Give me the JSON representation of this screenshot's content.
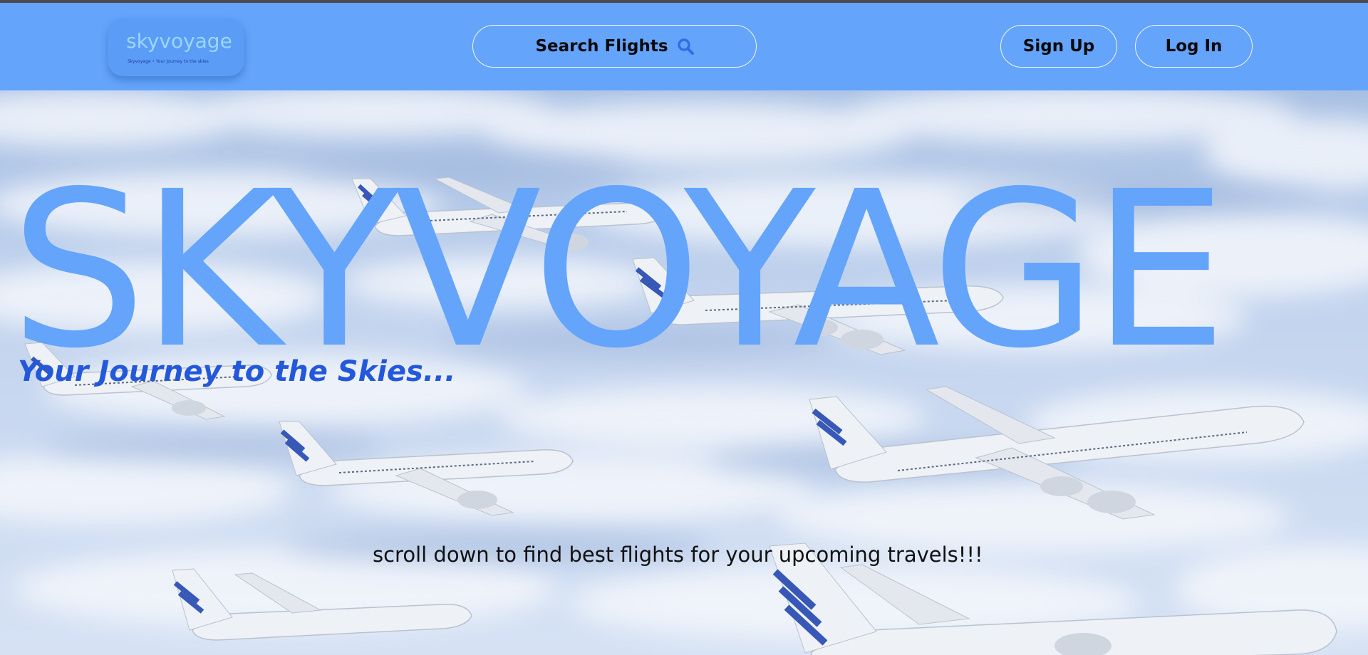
{
  "navbar": {
    "logo_text": "skyvoyage",
    "logo_tagline": "Skyvoyage • Your journey to the skies",
    "search_label": "Search Flights",
    "signup_label": "Sign Up",
    "login_label": "Log In"
  },
  "hero": {
    "title": "SKYVOYAGE",
    "subtitle": "Your Journey to the Skies...",
    "note": "scroll down to find best flights for your upcoming travels!!!"
  },
  "colors": {
    "navbar_bg": "#64a4fb",
    "title_color": "#64a4fb",
    "subtitle_color": "#2458db",
    "logo_text_color": "#9ad6ff"
  },
  "icons": {
    "search": "search-icon"
  }
}
